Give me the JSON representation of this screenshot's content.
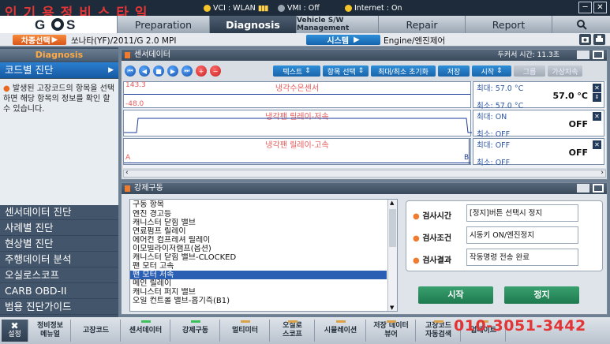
{
  "title_overlay": "인 기 용 정 비 스 타 일",
  "status": {
    "vci": "VCI : WLAN",
    "vmi": "VMI : Off",
    "internet": "Internet : On"
  },
  "colors": {
    "vci_dot": "#f5c32a",
    "vmi_dot": "#9aa5b2",
    "internet_dot": "#f5c32a",
    "accent": "#f07a2e"
  },
  "tabs": [
    "Preparation",
    "Diagnosis",
    "Vehicle S/W Management",
    "Repair",
    "Report"
  ],
  "active_tab": "Diagnosis",
  "vehicle": {
    "select_label": "차종선택",
    "model": "쏘나타(YF)/2011/G 2.0 MPI",
    "system_label": "시스템",
    "system_value": "Engine/엔진제어"
  },
  "sidebar": {
    "header": "Diagnosis",
    "top_item": "코드별 진단",
    "info_text": "발생된 고장코드의 항목을 선택하면 해당 항목의 정보를 확인 할 수 있습니다.",
    "items": [
      "센서데이터 진단",
      "사례별 진단",
      "현상별 진단",
      "주행데이터 분석",
      "오실로스코프",
      "CARB OBD-II",
      "범용 진단가이드"
    ]
  },
  "sensor_panel": {
    "title": "센서데이터",
    "capture_time": "두커서 시간: 11.3초",
    "toolbar": {
      "text_btn": "텍스트",
      "item_btn": "항목 선택",
      "reset_btn": "최대/최소 초기화",
      "save_btn": "저장",
      "start_btn": "시작",
      "group_btn": "그룹",
      "virtual_btn": "가상차속"
    },
    "graphs": [
      {
        "label": "냉각수온센서",
        "top_tick": "143.3",
        "bottom_tick": "-48.0",
        "max": "최대: 57.0 °C",
        "current": "57.0 °C",
        "min": "최소: 57.0 °C"
      },
      {
        "label": "냉각팬 릴레이-저속",
        "max": "최대: ON",
        "current": "OFF",
        "min": "최소: OFF"
      },
      {
        "label": "냉각팬 릴레이-고속",
        "max": "최대: OFF",
        "current": "OFF",
        "min": "최소: OFF",
        "cursor_a": "A",
        "cursor_b": "B"
      }
    ]
  },
  "force_panel": {
    "title": "강제구동",
    "list_header": "구동 항목",
    "items": [
      "엔진 경고등",
      "캐니스터 닫힘 밸브",
      "연료펌프 릴레이",
      "에어컨 컴프레셔 릴레이",
      "이모빌라이저램프(옵션)",
      "캐니스터 닫힘 밸브-CLOCKED",
      "팬 모터 고속",
      "팬 모터 저속",
      "메인 릴레이",
      "캐니스터 퍼지 밸브",
      "오일 컨트롤 밸브-흡기측(B1)"
    ],
    "selected": "팬 모터 저속",
    "test_time_label": "검사시간",
    "test_time_value": "[정지]버튼 선택시 정지",
    "test_cond_label": "검사조건",
    "test_cond_value": "시동키 ON/엔진정지",
    "test_result_label": "검사결과",
    "test_result_value": "작동명령 전송 완료",
    "start_btn": "시작",
    "stop_btn": "정지"
  },
  "bottom": {
    "settings": "설정",
    "buttons": [
      "정비정보\n메뉴얼",
      "고장코드",
      "센서데이터",
      "강제구동",
      "멀티미터",
      "오실로\n스코프",
      "시뮬레이션",
      "저장 데이터\n뷰어",
      "고장코드\n자동검색",
      "업데이트"
    ],
    "phone_overlay": "010-3051-3442"
  }
}
